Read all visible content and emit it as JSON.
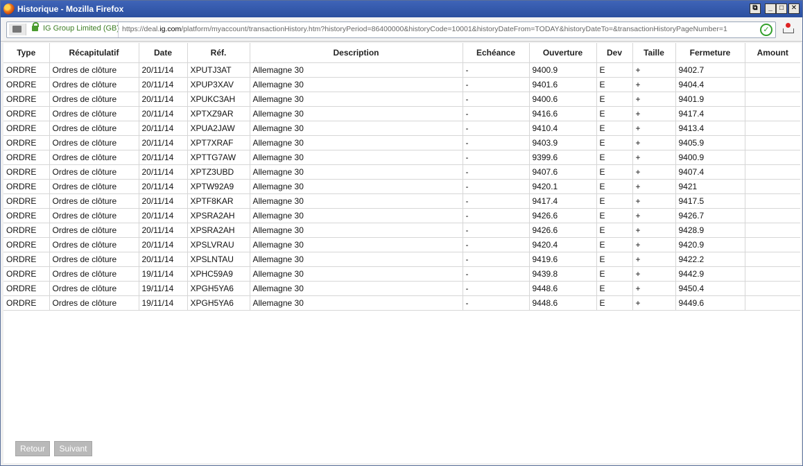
{
  "window": {
    "title": "Historique - Mozilla Firefox",
    "buttons": {
      "restore": "⧉",
      "minimize": "_",
      "maximize": "□",
      "close": "✕"
    }
  },
  "urlbar": {
    "identity": "IG Group Limited (GB)",
    "url_prefix": "https://deal.",
    "url_domain": "ig.com",
    "url_rest": "/platform/myaccount/transactionHistory.htm?historyPeriod=86400000&historyCode=10001&historyDateFrom=TODAY&historyDateTo=&transactionHistoryPageNumber=1"
  },
  "table": {
    "headers": [
      "Type",
      "Récapitulatif",
      "Date",
      "Réf.",
      "Description",
      "Echéance",
      "Ouverture",
      "Dev",
      "Taille",
      "Fermeture",
      "Amount"
    ],
    "rows": [
      [
        "ORDRE",
        "Ordres de clôture",
        "20/11/14",
        "XPUTJ3AT",
        "Allemagne 30",
        "-",
        "9400.9",
        "E",
        "+",
        "9402.7",
        ""
      ],
      [
        "ORDRE",
        "Ordres de clôture",
        "20/11/14",
        "XPUP3XAV",
        "Allemagne 30",
        "-",
        "9401.6",
        "E",
        "+",
        "9404.4",
        ""
      ],
      [
        "ORDRE",
        "Ordres de clôture",
        "20/11/14",
        "XPUKC3AH",
        "Allemagne 30",
        "-",
        "9400.6",
        "E",
        "+",
        "9401.9",
        ""
      ],
      [
        "ORDRE",
        "Ordres de clôture",
        "20/11/14",
        "XPTXZ9AR",
        "Allemagne 30",
        "-",
        "9416.6",
        "E",
        "+",
        "9417.4",
        ""
      ],
      [
        "ORDRE",
        "Ordres de clôture",
        "20/11/14",
        "XPUA2JAW",
        "Allemagne 30",
        "-",
        "9410.4",
        "E",
        "+",
        "9413.4",
        ""
      ],
      [
        "ORDRE",
        "Ordres de clôture",
        "20/11/14",
        "XPT7XRAF",
        "Allemagne 30",
        "-",
        "9403.9",
        "E",
        "+",
        "9405.9",
        ""
      ],
      [
        "ORDRE",
        "Ordres de clôture",
        "20/11/14",
        "XPTTG7AW",
        "Allemagne 30",
        "-",
        "9399.6",
        "E",
        "+",
        "9400.9",
        ""
      ],
      [
        "ORDRE",
        "Ordres de clôture",
        "20/11/14",
        "XPTZ3UBD",
        "Allemagne 30",
        "-",
        "9407.6",
        "E",
        "+",
        "9407.4",
        ""
      ],
      [
        "ORDRE",
        "Ordres de clôture",
        "20/11/14",
        "XPTW92A9",
        "Allemagne 30",
        "-",
        "9420.1",
        "E",
        "+",
        "9421",
        ""
      ],
      [
        "ORDRE",
        "Ordres de clôture",
        "20/11/14",
        "XPTF8KAR",
        "Allemagne 30",
        "-",
        "9417.4",
        "E",
        "+",
        "9417.5",
        ""
      ],
      [
        "ORDRE",
        "Ordres de clôture",
        "20/11/14",
        "XPSRA2AH",
        "Allemagne 30",
        "-",
        "9426.6",
        "E",
        "+",
        "9426.7",
        ""
      ],
      [
        "ORDRE",
        "Ordres de clôture",
        "20/11/14",
        "XPSRA2AH",
        "Allemagne 30",
        "-",
        "9426.6",
        "E",
        "+",
        "9428.9",
        ""
      ],
      [
        "ORDRE",
        "Ordres de clôture",
        "20/11/14",
        "XPSLVRAU",
        "Allemagne 30",
        "-",
        "9420.4",
        "E",
        "+",
        "9420.9",
        ""
      ],
      [
        "ORDRE",
        "Ordres de clôture",
        "20/11/14",
        "XPSLNTAU",
        "Allemagne 30",
        "-",
        "9419.6",
        "E",
        "+",
        "9422.2",
        ""
      ],
      [
        "ORDRE",
        "Ordres de clôture",
        "19/11/14",
        "XPHC59A9",
        "Allemagne 30",
        "-",
        "9439.8",
        "E",
        "+",
        "9442.9",
        ""
      ],
      [
        "ORDRE",
        "Ordres de clôture",
        "19/11/14",
        "XPGH5YA6",
        "Allemagne 30",
        "-",
        "9448.6",
        "E",
        "+",
        "9450.4",
        ""
      ],
      [
        "ORDRE",
        "Ordres de clôture",
        "19/11/14",
        "XPGH5YA6",
        "Allemagne 30",
        "-",
        "9448.6",
        "E",
        "+",
        "9449.6",
        ""
      ]
    ]
  },
  "pagination": {
    "previous": "Retour",
    "next": "Suivant"
  }
}
